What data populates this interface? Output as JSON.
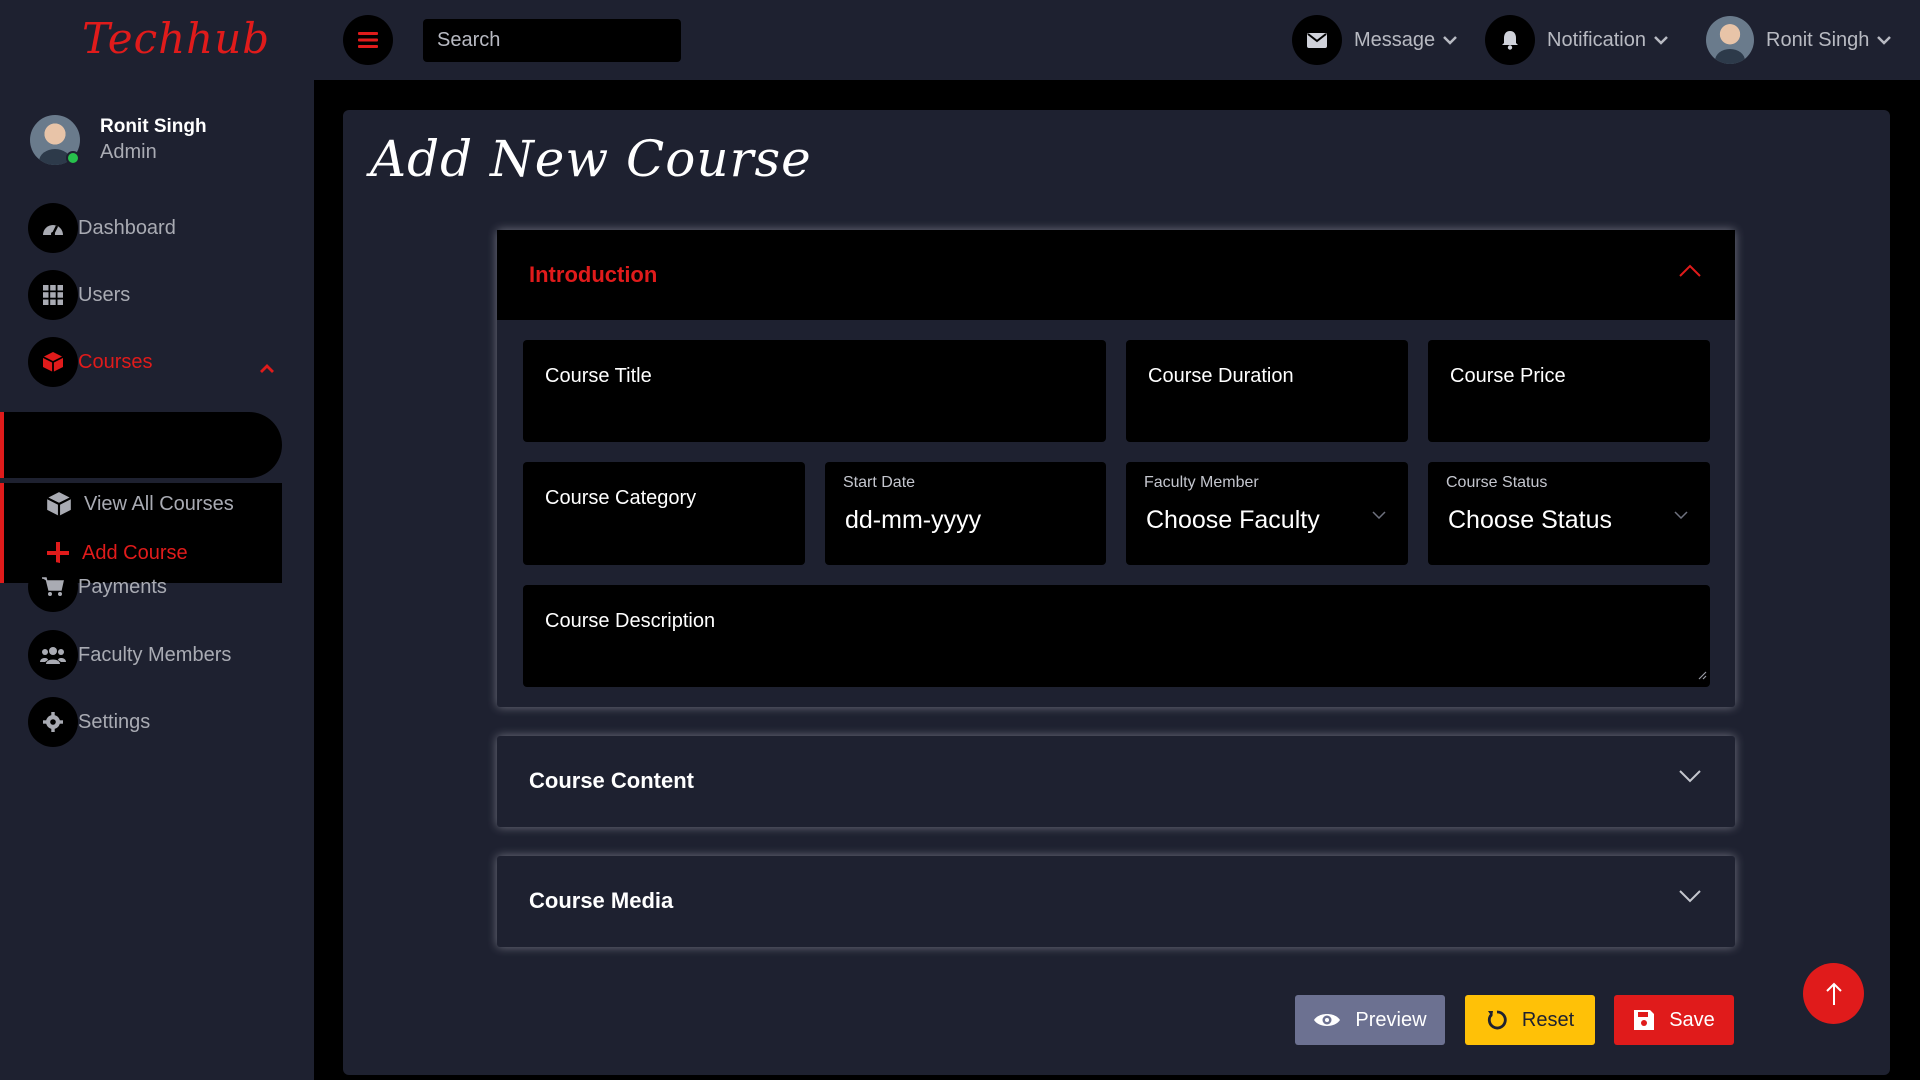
{
  "brand": {
    "logo_text": "Techhub"
  },
  "topbar": {
    "search_placeholder": "Search",
    "message_label": "Message",
    "notification_label": "Notification",
    "user_name": "Ronit Singh"
  },
  "sidebar": {
    "profile": {
      "name": "Ronit Singh",
      "role": "Admin"
    },
    "items": [
      {
        "label": "Dashboard",
        "icon": "gauge-icon"
      },
      {
        "label": "Users",
        "icon": "grid-icon"
      },
      {
        "label": "Courses",
        "icon": "box-icon",
        "active": true
      },
      {
        "label": "Payments",
        "icon": "cart-icon"
      },
      {
        "label": "Faculty Members",
        "icon": "users-icon"
      },
      {
        "label": "Settings",
        "icon": "gear-icon"
      }
    ],
    "submenu": [
      {
        "label": "View All Courses",
        "icon": "cube-icon"
      },
      {
        "label": "Add Course",
        "icon": "plus-icon",
        "active": true
      }
    ]
  },
  "main": {
    "title": "Add New Course",
    "sections": {
      "introduction": {
        "title": "Introduction",
        "fields": {
          "course_title": "Course Title",
          "course_duration": "Course Duration",
          "course_price": "Course Price",
          "course_category": "Course Category",
          "start_date_label": "Start Date",
          "start_date_value": "dd-mm-yyyy",
          "faculty_label": "Faculty Member",
          "faculty_value": "Choose Faculty",
          "status_label": "Course Status",
          "status_value": "Choose Status",
          "course_description": "Course Description"
        }
      },
      "content": {
        "title": "Course Content"
      },
      "media": {
        "title": "Course Media"
      }
    },
    "actions": {
      "preview": "Preview",
      "reset": "Reset",
      "save": "Save"
    }
  },
  "colors": {
    "accent": "#e01b1b",
    "panel": "#1e2130",
    "preview_btn": "#6c7191",
    "reset_btn": "#ffc107",
    "save_btn": "#e01b1b"
  }
}
